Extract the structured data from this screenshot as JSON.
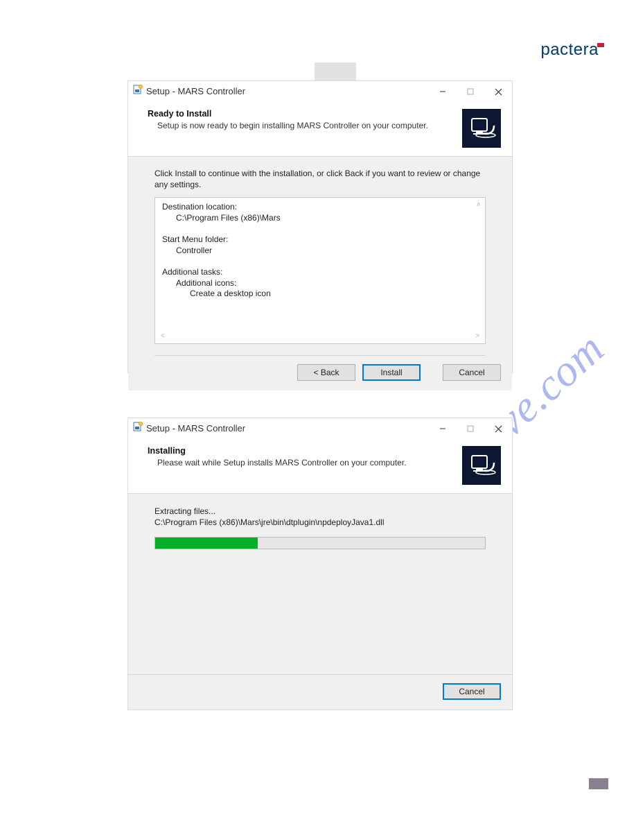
{
  "brand": "pactera",
  "watermark": "manualshive.com",
  "dialog1": {
    "title": "Setup - MARS Controller",
    "heading": "Ready to Install",
    "subheading": "Setup is now ready to begin installing MARS Controller on your computer.",
    "intro": "Click Install to continue with the installation, or click Back if you want to review or change any settings.",
    "summary": {
      "dest_label": "Destination location:",
      "dest_value": "C:\\Program Files (x86)\\Mars",
      "startmenu_label": "Start Menu folder:",
      "startmenu_value": "Controller",
      "tasks_label": "Additional tasks:",
      "tasks_sub": "Additional icons:",
      "tasks_item": "Create a desktop icon"
    },
    "buttons": {
      "back": "< Back",
      "install": "Install",
      "cancel": "Cancel"
    }
  },
  "dialog2": {
    "title": "Setup - MARS Controller",
    "heading": "Installing",
    "subheading": "Please wait while Setup installs MARS Controller on your computer.",
    "status_label": "Extracting files...",
    "status_path": "C:\\Program Files (x86)\\Mars\\jre\\bin\\dtplugin\\npdeployJava1.dll",
    "progress_percent": 31,
    "buttons": {
      "cancel": "Cancel"
    }
  }
}
